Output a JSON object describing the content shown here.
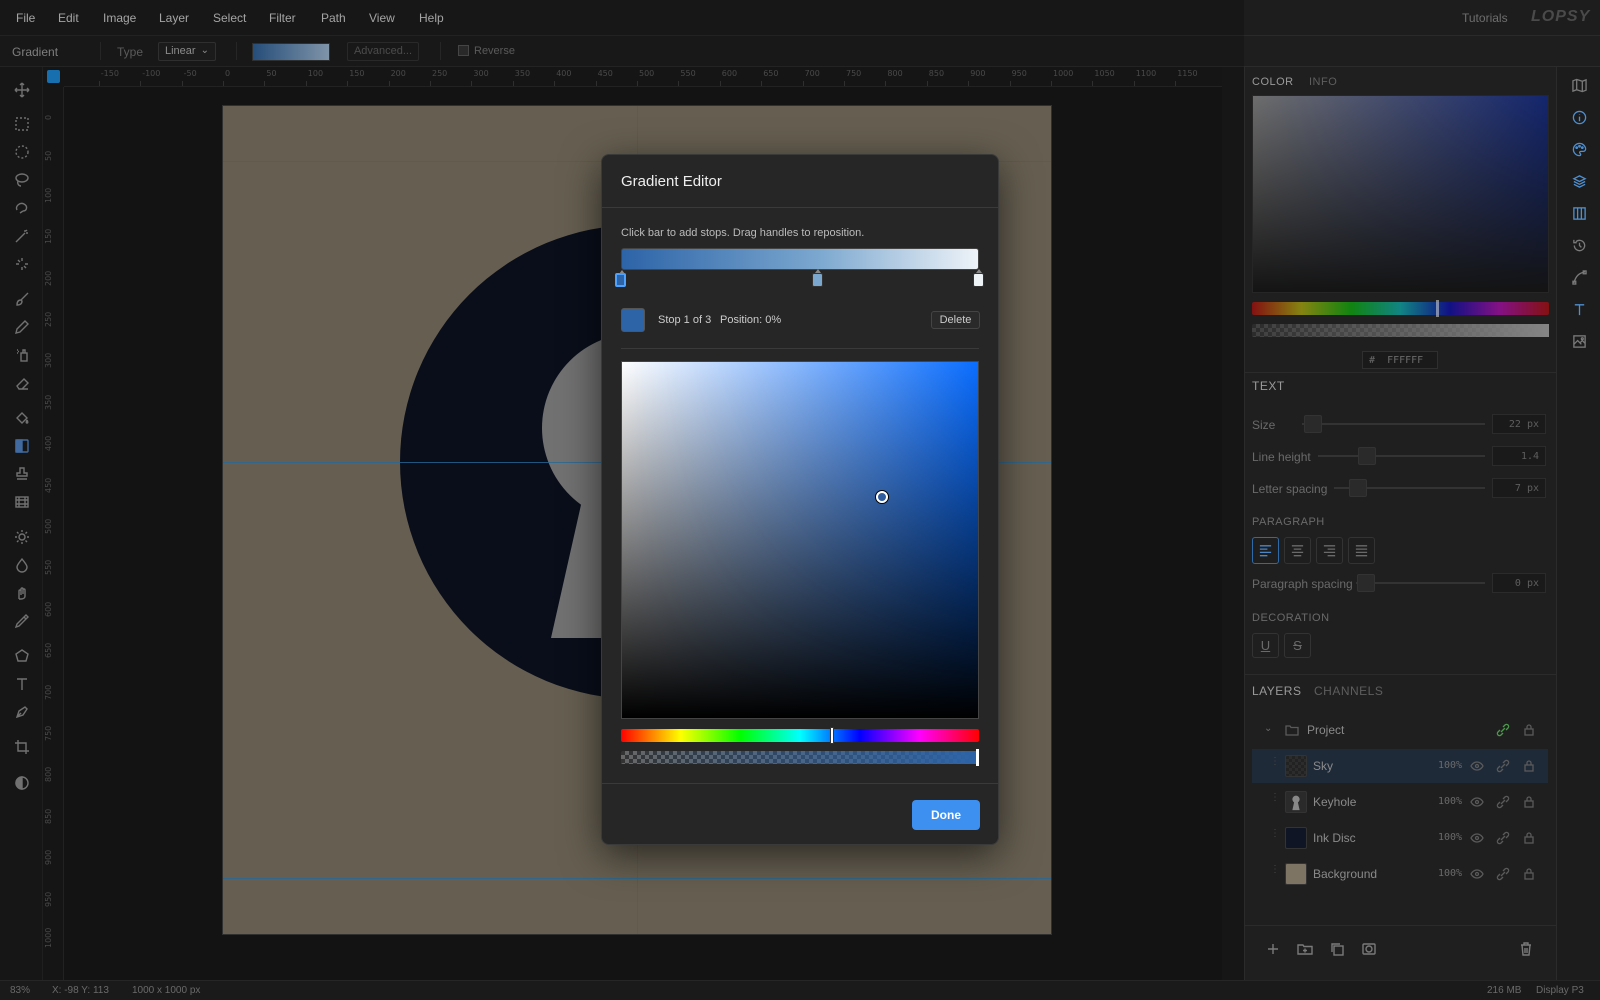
{
  "menu": [
    "File",
    "Edit",
    "Image",
    "Layer",
    "Select",
    "Filter",
    "Path",
    "View",
    "Help"
  ],
  "topbar": {
    "tutorials_label": "Tutorials",
    "logo_text": "LOPSY"
  },
  "options": {
    "tool_name": "Gradient",
    "type_label": "Type",
    "type_value": "Linear",
    "advanced_label": "Advanced...",
    "reverse_label": "Reverse",
    "reverse_checked": false
  },
  "rulers": {
    "h_labels": [
      "-150",
      "-100",
      "-50",
      "0",
      "50",
      "100",
      "150",
      "200",
      "250",
      "300",
      "350",
      "400",
      "450",
      "500",
      "550",
      "600",
      "650",
      "700",
      "750",
      "800",
      "850",
      "900",
      "950",
      "1000",
      "1050",
      "1100",
      "1150",
      "1200"
    ],
    "v_labels": [
      "0",
      "50",
      "100",
      "150",
      "200",
      "250",
      "300",
      "350",
      "400",
      "450",
      "500",
      "550",
      "600",
      "650",
      "700",
      "750",
      "800",
      "850",
      "900",
      "950",
      "1000"
    ]
  },
  "status": {
    "zoom": "83%",
    "cursor": "X: -98 Y: 113",
    "doc_size": "1000 x 1000 px",
    "memory": "216 MB",
    "color_profile": "Display P3"
  },
  "colors": {
    "accent": "#3d8ff0",
    "canvas_bg": "#7d7463",
    "disc": "#0c1220",
    "keyhole": "#8a8a8a",
    "stop_color": "#2d64a8"
  },
  "tools": [
    "move-icon",
    "rect-select-icon",
    "ellipse-select-icon",
    "lasso-icon",
    "magnetic-lasso-icon",
    "magic-wand-icon",
    "quick-select-icon",
    "brush-icon",
    "pencil-icon",
    "spray-icon",
    "eraser-icon",
    "bucket-icon",
    "gradient-icon",
    "stamp-icon",
    "film-icon",
    "dodge-icon",
    "blur-icon",
    "smudge-icon",
    "eyedropper-icon",
    "polygon-icon",
    "text-icon",
    "pen-icon",
    "crop-icon",
    "contrast-icon"
  ],
  "color_panel": {
    "tab_color": "COLOR",
    "tab_info": "INFO",
    "hex_prefix": "#",
    "hex_value": "FFFFFF"
  },
  "text_panel": {
    "title": "TEXT",
    "size_label": "Size",
    "size_value": "22 px",
    "line_height_label": "Line height",
    "line_height_value": "1.4",
    "letter_spacing_label": "Letter spacing",
    "letter_spacing_value": "7 px",
    "paragraph_head": "PARAGRAPH",
    "paragraph_spacing_label": "Paragraph spacing",
    "paragraph_spacing_value": "0 px",
    "decoration_head": "DECORATION",
    "underline": "U",
    "strike": "S"
  },
  "layers_panel": {
    "tab_layers": "LAYERS",
    "tab_channels": "CHANNELS",
    "group_name": "Project",
    "layers": [
      {
        "name": "Sky",
        "opacity": "100%"
      },
      {
        "name": "Keyhole",
        "opacity": "100%"
      },
      {
        "name": "Ink Disc",
        "opacity": "100%"
      },
      {
        "name": "Background",
        "opacity": "100%"
      }
    ]
  },
  "dialog": {
    "title": "Gradient Editor",
    "hint": "Click bar to add stops. Drag handles to reposition.",
    "stop_info": "Stop 1 of 3",
    "position_info": "Position: 0%",
    "delete_label": "Delete",
    "done_label": "Done",
    "stops": [
      {
        "position": 0,
        "color": "#2d64a8"
      },
      {
        "position": 55,
        "color": "#7ba7cf"
      },
      {
        "position": 100,
        "color": "#eef3f8"
      }
    ],
    "sv_cursor": {
      "saturation": 0.73,
      "value": 0.62
    },
    "hue_position": 0.59,
    "alpha_position": 1.0
  }
}
